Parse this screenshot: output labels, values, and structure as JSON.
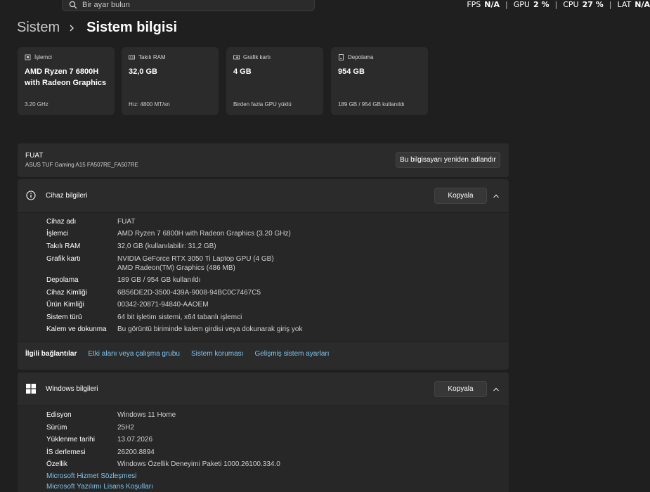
{
  "search": {
    "placeholder": "Bir ayar bulun"
  },
  "overlay": {
    "fps_label": "FPS",
    "fps_value": "N/A",
    "gpu_label": "GPU",
    "gpu_value": "2 %",
    "cpu_label": "CPU",
    "cpu_value": "27 %",
    "lat_label": "LAT",
    "lat_value": "N/A"
  },
  "breadcrumb": {
    "parent": "Sistem",
    "current": "Sistem bilgisi"
  },
  "cards": [
    {
      "caption": "İşlemci",
      "value": "AMD Ryzen 7 6800H with Radeon Graphics",
      "sub": "3.20 GHz",
      "icon": "cpu-icon"
    },
    {
      "caption": "Takılı RAM",
      "value": "32,0 GB",
      "sub": "Hız: 4800 MT/sn",
      "icon": "ram-icon"
    },
    {
      "caption": "Grafik kartı",
      "value": "4 GB",
      "sub": "Birden fazla GPU yüklü",
      "icon": "gpu-icon"
    },
    {
      "caption": "Depolama",
      "value": "954 GB",
      "sub": "189 GB / 954 GB kullanıldı",
      "icon": "storage-icon"
    }
  ],
  "device": {
    "name": "FUAT",
    "model": "ASUS TUF Gaming A15 FA507RE_FA507RE",
    "rename_button": "Bu bilgisayarı yeniden adlandır"
  },
  "device_info": {
    "title": "Cihaz bilgileri",
    "copy_button": "Kopyala",
    "rows": [
      {
        "key": "Cihaz adı",
        "value": "FUAT"
      },
      {
        "key": "İşlemci",
        "value": "AMD Ryzen 7 6800H with Radeon Graphics (3.20 GHz)"
      },
      {
        "key": "Takılı RAM",
        "value": "32,0 GB (kullanılabilir: 31,2 GB)"
      },
      {
        "key": "Grafik kartı",
        "value": "NVIDIA GeForce RTX 3050 Ti Laptop GPU (4 GB)",
        "value2": "AMD Radeon(TM) Graphics (486 MB)"
      },
      {
        "key": "Depolama",
        "value": "189 GB / 954 GB kullanıldı"
      },
      {
        "key": "Cihaz Kimliği",
        "value": "6B56DE2D-3500-439A-9008-94BC0C7467C5"
      },
      {
        "key": "Ürün Kimliği",
        "value": "00342-20871-94840-AAOEM"
      },
      {
        "key": "Sistem türü",
        "value": "64 bit işletim sistemi, x64 tabanlı işlemci"
      },
      {
        "key": "Kalem ve dokunma",
        "value": "Bu görüntü biriminde kalem girdisi veya dokunarak giriş yok"
      }
    ]
  },
  "related": {
    "label": "İlgili bağlantılar",
    "links": [
      "Etki alanı veya çalışma grubu",
      "Sistem koruması",
      "Gelişmiş sistem ayarları"
    ]
  },
  "windows_info": {
    "title": "Windows bilgileri",
    "copy_button": "Kopyala",
    "rows": [
      {
        "key": "Edisyon",
        "value": "Windows 11 Home"
      },
      {
        "key": "Sürüm",
        "value": "25H2"
      },
      {
        "key": "Yüklenme tarihi",
        "value": "13.07.2026"
      },
      {
        "key": "İS derlemesi",
        "value": "26200.8894"
      },
      {
        "key": "Özellik",
        "value": "Windows Özellik Deneyimi Paketi 1000.26100.334.0"
      }
    ],
    "links": [
      "Microsoft Hizmet Sözleşmesi",
      "Microsoft Yazılımı Lisans Koşulları"
    ]
  }
}
